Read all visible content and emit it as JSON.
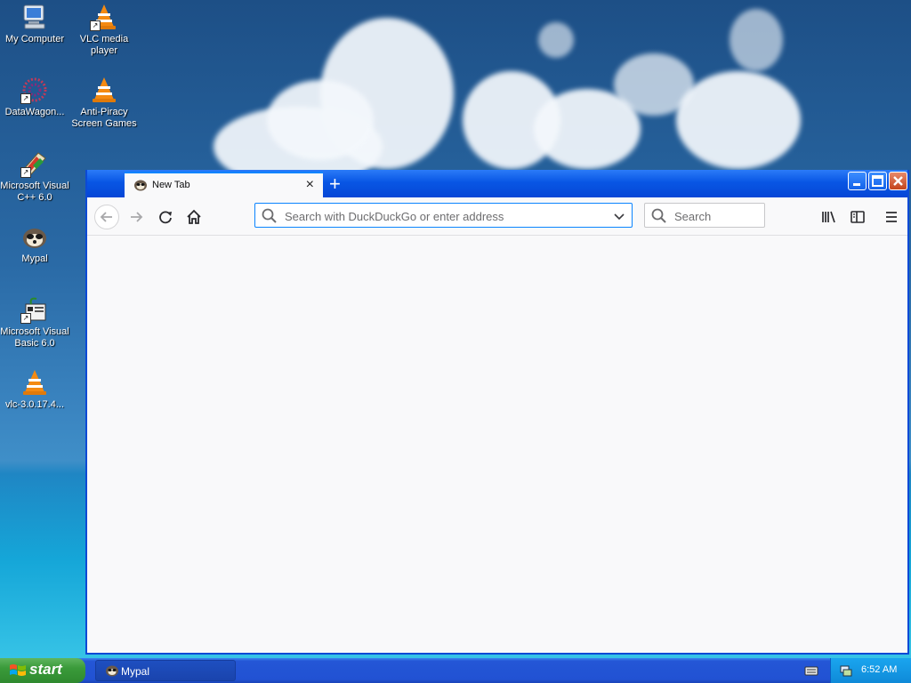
{
  "desktop": {
    "icons": [
      {
        "label": "My Computer",
        "icon": "my-computer-icon"
      },
      {
        "label": "VLC media player",
        "icon": "vlc-icon"
      },
      {
        "label": "DataWagon...",
        "icon": "datawagon-icon"
      },
      {
        "label": "Anti-Piracy Screen Games",
        "icon": "vlc-icon"
      },
      {
        "label": "Microsoft Visual C++ 6.0",
        "icon": "visual-cpp-icon"
      },
      {
        "label": "Mypal",
        "icon": "mypal-icon"
      },
      {
        "label": "Microsoft Visual Basic 6.0",
        "icon": "visual-basic-icon"
      },
      {
        "label": "vlc-3.0.17.4...",
        "icon": "vlc-icon"
      }
    ]
  },
  "browser": {
    "tab": {
      "title": "New Tab",
      "close": "×"
    },
    "new_tab": "+",
    "urlbar": {
      "placeholder": "Search with DuckDuckGo or enter address"
    },
    "searchbar": {
      "placeholder": "Search"
    },
    "window_buttons": {
      "minimize": "–",
      "maximize": "□",
      "close": "✕"
    }
  },
  "taskbar": {
    "start_label": "start",
    "task_label": "Mypal",
    "clock": "6:52 AM"
  },
  "colors": {
    "accent": "#0a84ff",
    "titlebar": "#0856e4",
    "taskbar": "#2152d3",
    "start": "#3a9a3a"
  }
}
